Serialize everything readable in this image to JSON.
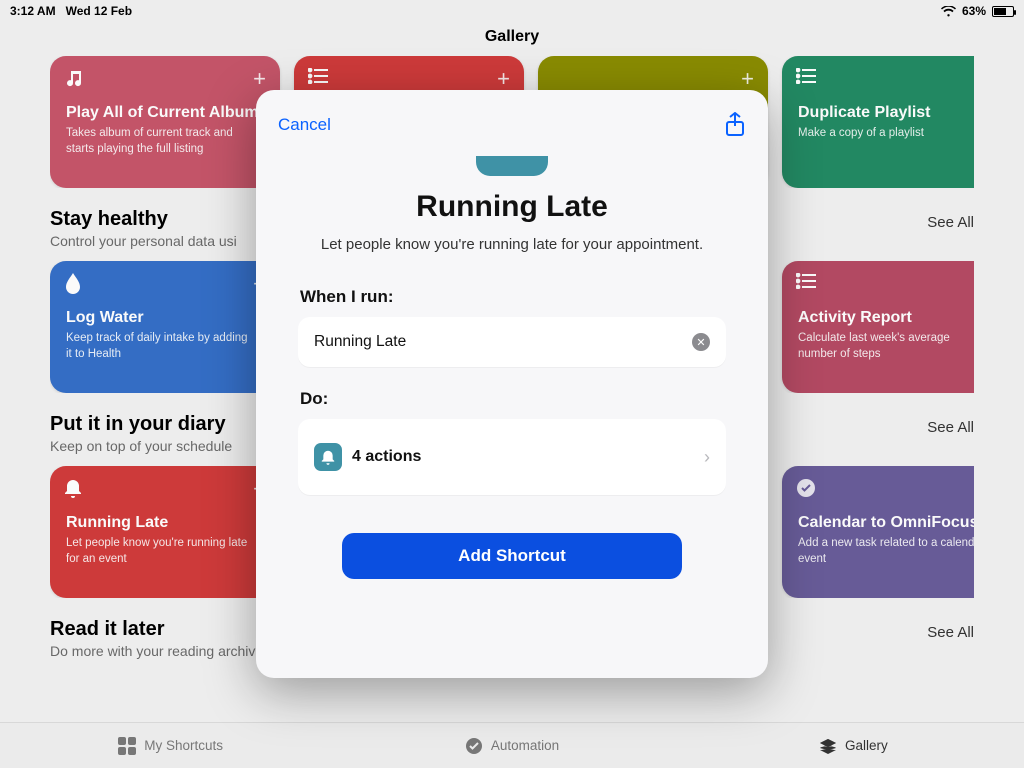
{
  "status": {
    "time": "3:12 AM",
    "date": "Wed 12 Feb",
    "battery_pct": "63%"
  },
  "page_title": "Gallery",
  "row0": {
    "card_a": {
      "title": "Play All of Current Album",
      "sub": "Takes album of current track and starts playing the full listing"
    },
    "card_d": {
      "title": "Duplicate Playlist",
      "sub": "Make a copy of a playlist"
    }
  },
  "sec1": {
    "heading": "Stay healthy",
    "sub": "Control your personal data usi",
    "see_all": "See All",
    "card_a": {
      "title": "Log Water",
      "sub": "Keep track of daily intake by adding it to Health"
    },
    "card_d": {
      "title": "Activity Report",
      "sub": "Calculate last week's average number of steps"
    }
  },
  "sec2": {
    "heading": "Put it in your diary",
    "sub": "Keep on top of your schedule",
    "see_all": "See All",
    "card_a": {
      "title": "Running Late",
      "sub": "Let people know you're running late for an event"
    },
    "card_d": {
      "title": "Calendar to OmniFocus",
      "sub": "Add a new task related to a calendar event"
    }
  },
  "sec3": {
    "heading": "Read it later",
    "sub": "Do more with your reading archive",
    "see_all": "See All"
  },
  "tabs": {
    "my": "My Shortcuts",
    "automation": "Automation",
    "gallery": "Gallery"
  },
  "modal": {
    "cancel": "Cancel",
    "title": "Running Late",
    "description": "Let people know you're running late for your appointment.",
    "when_label": "When I run:",
    "when_value": "Running Late",
    "do_label": "Do:",
    "do_count": "4 actions",
    "add": "Add Shortcut"
  }
}
